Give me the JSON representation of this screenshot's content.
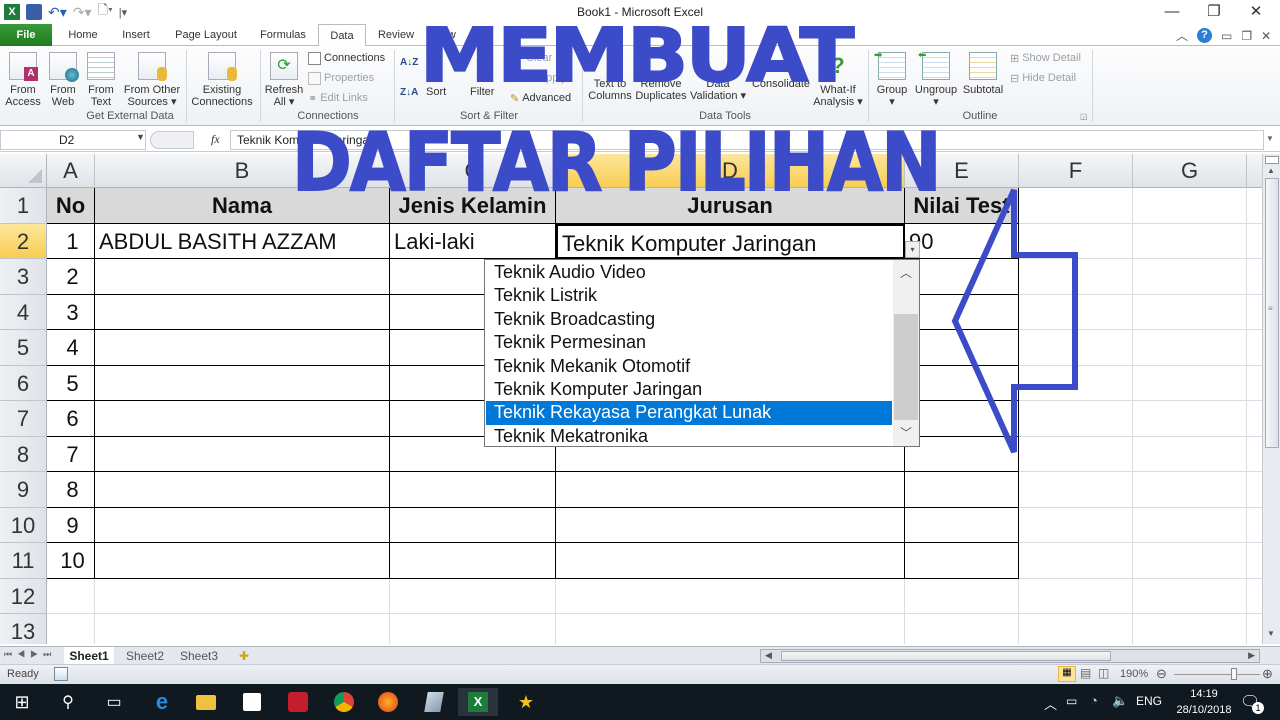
{
  "window": {
    "title": "Book1  -  Microsoft Excel",
    "minimize": "—",
    "restore": "❐",
    "close": "✕"
  },
  "ribbon_tabs": [
    {
      "label": "File"
    },
    {
      "label": "Home"
    },
    {
      "label": "Insert"
    },
    {
      "label": "Page Layout"
    },
    {
      "label": "Formulas"
    },
    {
      "label": "Data"
    },
    {
      "label": "Review"
    },
    {
      "label": "View"
    }
  ],
  "ribbon": {
    "get_external": {
      "from_access": [
        "From",
        "Access"
      ],
      "from_web": [
        "From",
        "Web"
      ],
      "from_text": [
        "From",
        "Text"
      ],
      "from_other": [
        "From Other",
        "Sources ▾"
      ],
      "existing": [
        "Existing",
        "Connections"
      ],
      "group": "Get External Data"
    },
    "connections": {
      "refresh": [
        "Refresh",
        "All ▾"
      ],
      "connections": "Connections",
      "properties": "Properties",
      "edit_links": "Edit Links",
      "group": "Connections"
    },
    "sort_filter": {
      "sort_az": "A↓Z",
      "sort_za": "Z↓A",
      "sort": "Sort",
      "filter": "Filter",
      "clear": "Clear",
      "reapply": "Reapply",
      "advanced": "Advanced",
      "group": "Sort & Filter"
    },
    "data_tools": {
      "text_to_columns": [
        "Text to",
        "Columns"
      ],
      "remove_duplicates": [
        "Remove",
        "Duplicates"
      ],
      "data_validation": [
        "Data",
        "Validation ▾"
      ],
      "consolidate": "Consolidate",
      "what_if": [
        "What-If",
        "Analysis ▾"
      ],
      "group": "Data Tools"
    },
    "outline": {
      "group_btn": [
        "Group",
        "▾"
      ],
      "ungroup": [
        "Ungroup",
        "▾"
      ],
      "subtotal": "Subtotal",
      "show_detail": "Show Detail",
      "hide_detail": "Hide Detail",
      "group": "Outline"
    }
  },
  "formula_bar": {
    "name_box": "D2",
    "fx": "fx",
    "content": "Teknik Komputer Jaringan"
  },
  "columns": [
    "A",
    "B",
    "C",
    "D",
    "E",
    "F",
    "G"
  ],
  "rows": [
    "1",
    "2",
    "3",
    "4",
    "5",
    "6",
    "7",
    "8",
    "9",
    "10",
    "11",
    "12",
    "13"
  ],
  "table": {
    "headers": [
      "No",
      "Nama",
      "Jenis Kelamin",
      "Jurusan",
      "Nilai Test"
    ],
    "rows": [
      [
        "1",
        "ABDUL BASITH AZZAM",
        "Laki-laki",
        "Teknik Komputer Jaringan",
        "90"
      ],
      [
        "2",
        "",
        "",
        "",
        ""
      ],
      [
        "3",
        "",
        "",
        "",
        ""
      ],
      [
        "4",
        "",
        "",
        "",
        ""
      ],
      [
        "5",
        "",
        "",
        "",
        ""
      ],
      [
        "6",
        "",
        "",
        "",
        ""
      ],
      [
        "7",
        "",
        "",
        "",
        ""
      ],
      [
        "8",
        "",
        "",
        "",
        ""
      ],
      [
        "9",
        "",
        "",
        "",
        ""
      ],
      [
        "10",
        "",
        "",
        "",
        ""
      ]
    ]
  },
  "dropdown": {
    "items": [
      "Teknik Audio Video",
      "Teknik Listrik",
      "Teknik Broadcasting",
      "Teknik Permesinan",
      "Teknik Mekanik Otomotif",
      "Teknik Komputer Jaringan",
      "Teknik Rekayasa Perangkat Lunak",
      "Teknik Mekatronika"
    ],
    "highlighted_index": 6,
    "highlight_color": "#0078d7"
  },
  "sheets": [
    "Sheet1",
    "Sheet2",
    "Sheet3"
  ],
  "active_sheet": "Sheet1",
  "status": {
    "ready": "Ready",
    "zoom": "190%",
    "zoom_fraction": 0.7
  },
  "taskbar": {
    "language": "ENG",
    "time": "14:19",
    "date": "28/10/2018",
    "notifications": "1"
  },
  "overlay": {
    "line1": "MEMBUAT",
    "line2": "DAFTAR PILIHAN",
    "color": "#3c4bc8"
  }
}
